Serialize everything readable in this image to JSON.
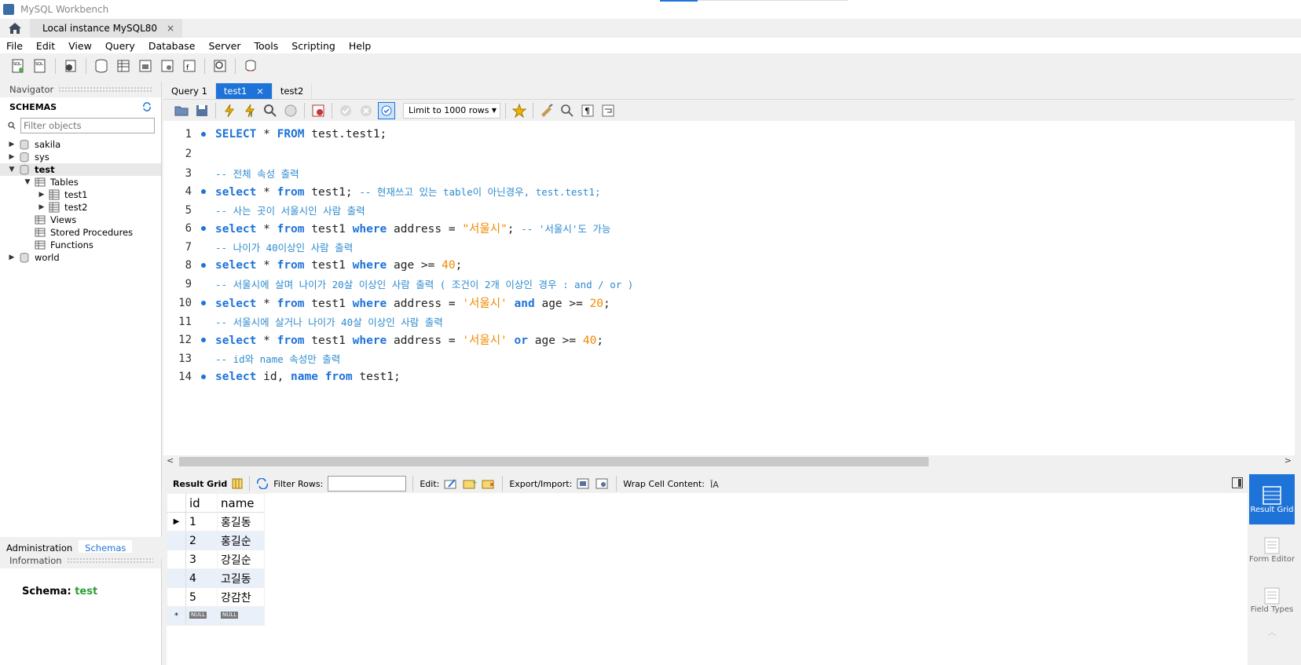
{
  "window": {
    "title": "MySQL Workbench"
  },
  "connection_tab": {
    "label": "Local instance MySQL80",
    "close": "×"
  },
  "menu": [
    "File",
    "Edit",
    "View",
    "Query",
    "Database",
    "Server",
    "Tools",
    "Scripting",
    "Help"
  ],
  "navigator": {
    "title": "Navigator",
    "schemas_label": "SCHEMAS",
    "filter_placeholder": "Filter objects",
    "tree": [
      {
        "label": "sakila",
        "expanded": false
      },
      {
        "label": "sys",
        "expanded": false
      },
      {
        "label": "test",
        "expanded": true,
        "selected": true
      },
      {
        "label": "Tables",
        "expanded": true
      },
      {
        "label": "test1",
        "expanded": false
      },
      {
        "label": "test2",
        "expanded": false
      },
      {
        "label": "Views"
      },
      {
        "label": "Stored Procedures"
      },
      {
        "label": "Functions"
      },
      {
        "label": "world",
        "expanded": false
      }
    ],
    "bottom_tabs": [
      "Administration",
      "Schemas"
    ],
    "active_bottom_tab": "Schemas"
  },
  "information": {
    "title": "Information",
    "schema_label": "Schema:",
    "schema_value": "test"
  },
  "query_tabs": [
    {
      "label": "Query 1",
      "active": false
    },
    {
      "label": "test1",
      "active": true,
      "close": "×"
    },
    {
      "label": "test2",
      "active": false
    }
  ],
  "sql_toolbar": {
    "limit_label": "Limit to 1000 rows"
  },
  "editor": {
    "lines": [
      {
        "n": "1",
        "dot": true,
        "parts": [
          [
            "kw",
            "SELECT"
          ],
          [
            "plain",
            " * "
          ],
          [
            "kw",
            "FROM"
          ],
          [
            "plain",
            " test.test1;"
          ]
        ]
      },
      {
        "n": "2",
        "dot": false,
        "parts": []
      },
      {
        "n": "3",
        "dot": false,
        "parts": [
          [
            "cm",
            "-- 전체 속성 출력"
          ]
        ]
      },
      {
        "n": "4",
        "dot": true,
        "parts": [
          [
            "kw",
            "select"
          ],
          [
            "plain",
            " * "
          ],
          [
            "kw",
            "from"
          ],
          [
            "plain",
            " test1; "
          ],
          [
            "cm",
            "-- 현재쓰고 있는 table이 아닌경우, test.test1;"
          ]
        ]
      },
      {
        "n": "5",
        "dot": false,
        "parts": [
          [
            "cm",
            "-- 사는 곳이 서울시인 사람 출력"
          ]
        ]
      },
      {
        "n": "6",
        "dot": true,
        "parts": [
          [
            "kw",
            "select"
          ],
          [
            "plain",
            " * "
          ],
          [
            "kw",
            "from"
          ],
          [
            "plain",
            " test1 "
          ],
          [
            "kw",
            "where"
          ],
          [
            "plain",
            " address = "
          ],
          [
            "str",
            "\"서울시\""
          ],
          [
            "plain",
            "; "
          ],
          [
            "cm",
            "-- '서울시'도 가능"
          ]
        ]
      },
      {
        "n": "7",
        "dot": false,
        "parts": [
          [
            "cm",
            "-- 나이가 40이상인 사람 출력"
          ]
        ]
      },
      {
        "n": "8",
        "dot": true,
        "parts": [
          [
            "kw",
            "select"
          ],
          [
            "plain",
            " * "
          ],
          [
            "kw",
            "from"
          ],
          [
            "plain",
            " test1 "
          ],
          [
            "kw",
            "where"
          ],
          [
            "plain",
            " age >= "
          ],
          [
            "num",
            "40"
          ],
          [
            "plain",
            ";"
          ]
        ]
      },
      {
        "n": "9",
        "dot": false,
        "parts": [
          [
            "cm",
            "-- 서울시에 살며 나이가 20살 이상인 사람 출력 ( 조건이 2개 이상인 경우 : and / or )"
          ]
        ]
      },
      {
        "n": "10",
        "dot": true,
        "parts": [
          [
            "kw",
            "select"
          ],
          [
            "plain",
            " * "
          ],
          [
            "kw",
            "from"
          ],
          [
            "plain",
            " test1 "
          ],
          [
            "kw",
            "where"
          ],
          [
            "plain",
            " address = "
          ],
          [
            "str",
            "'서울시'"
          ],
          [
            "plain",
            " "
          ],
          [
            "kw",
            "and"
          ],
          [
            "plain",
            " age >= "
          ],
          [
            "num",
            "20"
          ],
          [
            "plain",
            ";"
          ]
        ]
      },
      {
        "n": "11",
        "dot": false,
        "parts": [
          [
            "cm",
            "-- 서울시에 살거나 나이가 40살 이상인 사람 출력"
          ]
        ]
      },
      {
        "n": "12",
        "dot": true,
        "parts": [
          [
            "kw",
            "select"
          ],
          [
            "plain",
            " * "
          ],
          [
            "kw",
            "from"
          ],
          [
            "plain",
            " test1 "
          ],
          [
            "kw",
            "where"
          ],
          [
            "plain",
            " address = "
          ],
          [
            "str",
            "'서울시'"
          ],
          [
            "plain",
            " "
          ],
          [
            "kw",
            "or"
          ],
          [
            "plain",
            " age >= "
          ],
          [
            "num",
            "40"
          ],
          [
            "plain",
            ";"
          ]
        ]
      },
      {
        "n": "13",
        "dot": false,
        "parts": [
          [
            "cm",
            "-- id와 name 속성만 출력"
          ]
        ]
      },
      {
        "n": "14",
        "dot": true,
        "parts": [
          [
            "kw",
            "select"
          ],
          [
            "plain",
            " id, "
          ],
          [
            "kw",
            "name"
          ],
          [
            "plain",
            " "
          ],
          [
            "kw",
            "from"
          ],
          [
            "plain",
            " test1;"
          ]
        ]
      }
    ]
  },
  "result_toolbar": {
    "result_grid_label": "Result Grid",
    "filter_rows_label": "Filter Rows:",
    "edit_label": "Edit:",
    "export_import_label": "Export/Import:",
    "wrap_label": "Wrap Cell Content:"
  },
  "result_grid": {
    "columns": [
      "id",
      "name"
    ],
    "rows": [
      [
        "1",
        "홍길동"
      ],
      [
        "2",
        "홍길순"
      ],
      [
        "3",
        "강길순"
      ],
      [
        "4",
        "고길동"
      ],
      [
        "5",
        "강감찬"
      ]
    ],
    "null_label": "NULL"
  },
  "side_panel": [
    {
      "label": "Result Grid",
      "active": true
    },
    {
      "label": "Form Editor",
      "active": false
    },
    {
      "label": "Field Types",
      "active": false
    }
  ],
  "colors": {
    "accent": "#1e73d8",
    "keyword": "#1e73d8",
    "comment": "#2c8bcf",
    "number": "#f08a00",
    "schema_value": "#2aa036"
  }
}
